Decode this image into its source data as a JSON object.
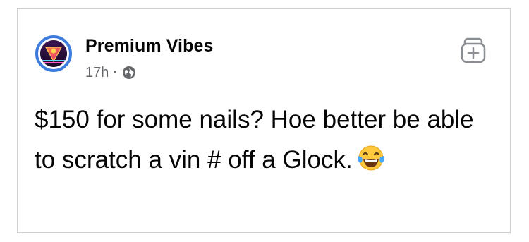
{
  "post": {
    "author": "Premium Vibes",
    "time": "17h",
    "separator": "·",
    "privacy_icon": "globe-icon",
    "avatar_icon": "premium-vibes-logo",
    "save_icon": "bookmark-plus-icon",
    "text": "$150 for some nails? Hoe better be able to scratch a vin # off a Glock.",
    "emoji": "face-with-tears-of-joy"
  },
  "colors": {
    "avatar_ring": "#3e7bdf",
    "text_primary": "#050505",
    "text_secondary": "#65676b",
    "border": "#cfcfcf"
  }
}
